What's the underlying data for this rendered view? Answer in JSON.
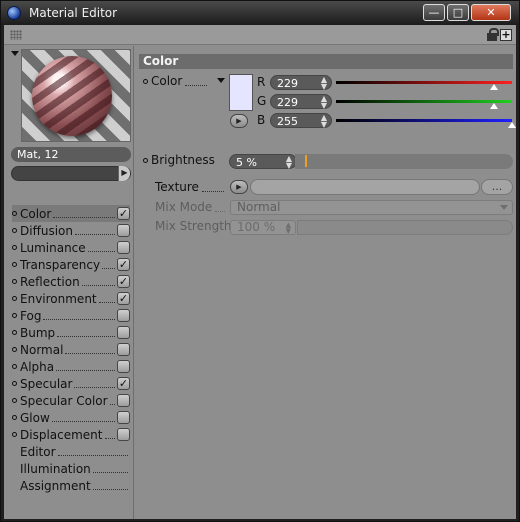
{
  "window": {
    "title": "Material Editor"
  },
  "titlebar_buttons": {
    "minimize": "—",
    "maximize": "□",
    "close": "✕"
  },
  "material": {
    "name": "Mat, 12"
  },
  "channels": [
    {
      "label": "Color",
      "checked": true,
      "has_dot": true,
      "active": true
    },
    {
      "label": "Diffusion",
      "checked": false,
      "has_dot": true
    },
    {
      "label": "Luminance",
      "checked": false,
      "has_dot": true
    },
    {
      "label": "Transparency",
      "checked": true,
      "has_dot": true
    },
    {
      "label": "Reflection",
      "checked": true,
      "has_dot": true
    },
    {
      "label": "Environment",
      "checked": true,
      "has_dot": true
    },
    {
      "label": "Fog",
      "checked": false,
      "has_dot": true
    },
    {
      "label": "Bump",
      "checked": false,
      "has_dot": true
    },
    {
      "label": "Normal",
      "checked": false,
      "has_dot": true
    },
    {
      "label": "Alpha",
      "checked": false,
      "has_dot": true
    },
    {
      "label": "Specular",
      "checked": true,
      "has_dot": true
    },
    {
      "label": "Specular Color",
      "checked": false,
      "has_dot": true
    },
    {
      "label": "Glow",
      "checked": false,
      "has_dot": true
    },
    {
      "label": "Displacement",
      "checked": false,
      "has_dot": true
    },
    {
      "label": "Editor",
      "checked": null,
      "has_dot": false
    },
    {
      "label": "Illumination",
      "checked": null,
      "has_dot": false
    },
    {
      "label": "Assignment",
      "checked": null,
      "has_dot": false
    }
  ],
  "color_section": {
    "title": "Color",
    "color_label": "Color",
    "swatch_color": "#e5e5ff",
    "r": {
      "letter": "R",
      "value": "229",
      "fraction": 0.898,
      "gradient": [
        "#000000",
        "#ff2020"
      ]
    },
    "g": {
      "letter": "G",
      "value": "229",
      "fraction": 0.898,
      "gradient": [
        "#000000",
        "#20d020"
      ]
    },
    "b": {
      "letter": "B",
      "value": "255",
      "fraction": 1.0,
      "gradient": [
        "#000000",
        "#2020ff"
      ]
    },
    "brightness_label": "Brightness",
    "brightness_value": "5 %",
    "brightness_fraction": 0.05,
    "texture_label": "Texture",
    "texture_button": "...",
    "mix_mode_label": "Mix Mode",
    "mix_mode_value": "Normal",
    "mix_strength_label": "Mix Strength",
    "mix_strength_value": "100 %"
  },
  "colors": {
    "accent_orange": "#f0a020",
    "panel_bg": "#8e8e8e"
  }
}
